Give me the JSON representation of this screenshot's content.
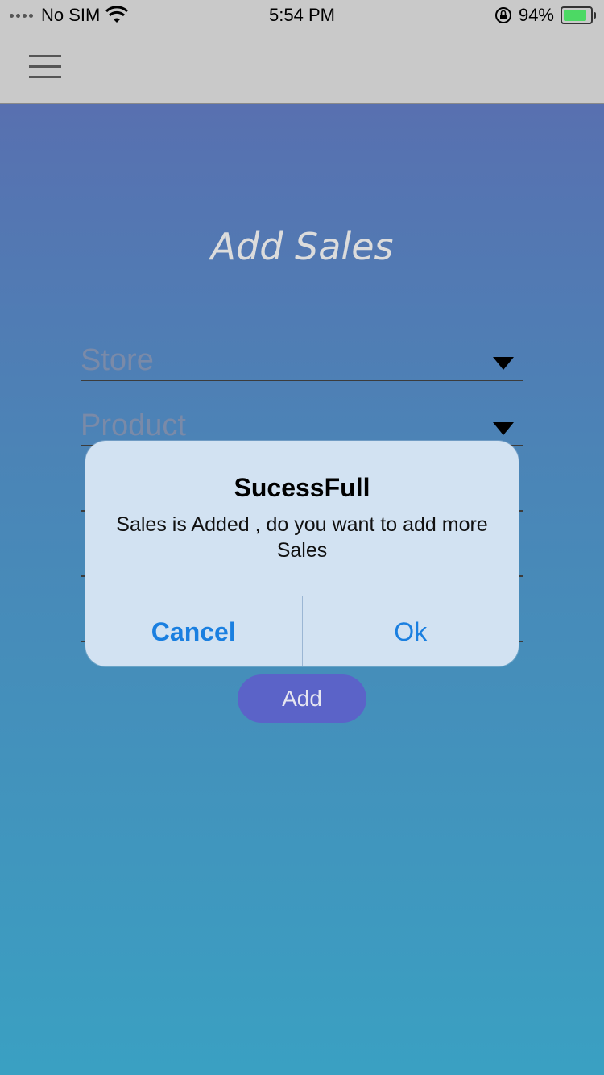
{
  "status_bar": {
    "carrier": "No SIM",
    "time": "5:54 PM",
    "battery": "94%",
    "battery_level": 0.94,
    "icons": [
      "signal-dots-icon",
      "wifi-icon",
      "rotation-lock-icon",
      "battery-charging-icon"
    ]
  },
  "nav": {
    "menu_icon": "hamburger-icon"
  },
  "page": {
    "title": "Add Sales",
    "fields": [
      {
        "label": "Store"
      },
      {
        "label": "Product"
      }
    ],
    "add_button": "Add"
  },
  "alert": {
    "title": "SucessFull",
    "message": "Sales is  Added , do you want to add more Sales",
    "cancel": "Cancel",
    "ok": "Ok"
  },
  "colors": {
    "topbar": "#c9c9c9",
    "gradient_top": "#5870b0",
    "gradient_bottom": "#3aa0c2",
    "add_button": "#5b63c8",
    "alert_button_text": "#1a7fe0"
  }
}
